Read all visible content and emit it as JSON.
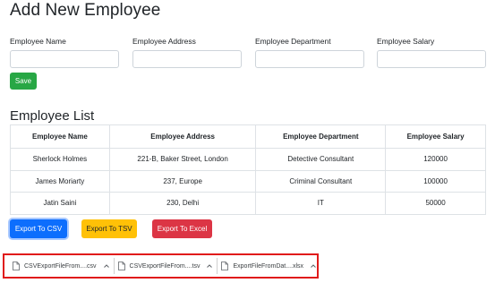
{
  "page_title": "Add New Employee",
  "form": {
    "fields": [
      {
        "label": "Employee Name",
        "value": ""
      },
      {
        "label": "Employee Address",
        "value": ""
      },
      {
        "label": "Employee Department",
        "value": ""
      },
      {
        "label": "Employee Salary",
        "value": ""
      }
    ],
    "save_label": "Save"
  },
  "list": {
    "title": "Employee List",
    "columns": [
      "Employee Name",
      "Employee Address",
      "Employee Department",
      "Employee Salary"
    ],
    "rows": [
      [
        "Sherlock Holmes",
        "221-B, Baker Street, London",
        "Detective Consultant",
        "120000"
      ],
      [
        "James Moriarty",
        "237, Europe",
        "Criminal Consultant",
        "100000"
      ],
      [
        "Jatin Saini",
        "230, Delhi",
        "IT",
        "50000"
      ]
    ]
  },
  "export": {
    "csv_label": "Export To CSV",
    "tsv_label": "Export To TSV",
    "excel_label": "Export To Excel"
  },
  "downloads": {
    "items": [
      {
        "name": "CSVExportFileFrom....csv",
        "icon": "file-icon"
      },
      {
        "name": "CSVExportFileFrom....tsv",
        "icon": "file-icon"
      },
      {
        "name": "ExportFileFromDat....xlsx",
        "icon": "file-icon"
      }
    ]
  },
  "colors": {
    "save": "#28a745",
    "csv": "#0d6efd",
    "tsv": "#ffc107",
    "excel": "#dc3545",
    "highlight_border": "#e01b1b"
  }
}
